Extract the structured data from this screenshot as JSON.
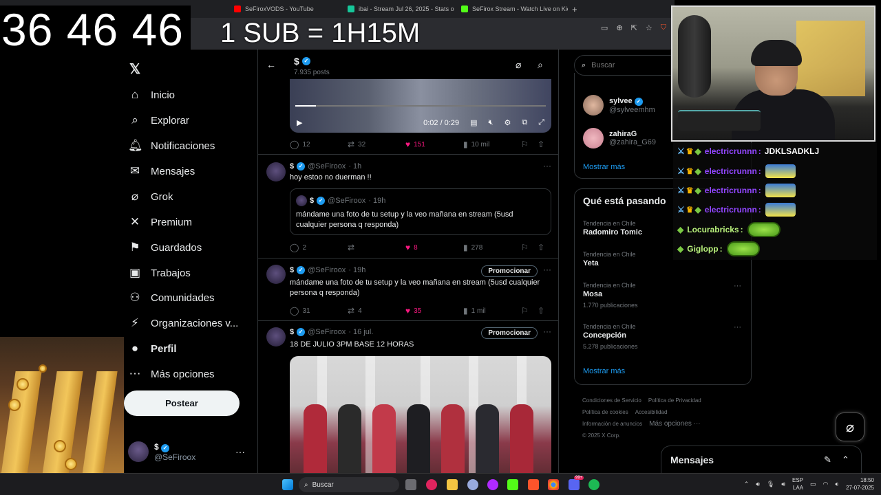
{
  "overlay": {
    "timer": "36 46 46",
    "sub_rate": "1 SUB = 1H15M"
  },
  "browser": {
    "tabs": [
      {
        "label": "SeFiroxVODS - YouTube",
        "color": "#ff0000"
      },
      {
        "label": "ibai - Stream Jul 26, 2025 - Stats on",
        "color": "#16c79a"
      },
      {
        "label": "SeFirox Stream - Watch Live on Kick",
        "color": "#53fc18"
      }
    ],
    "new_tab": "+"
  },
  "x": {
    "logo": "𝕏",
    "nav": [
      {
        "label": "Inicio",
        "icon": "home-icon",
        "glyph": "⌂"
      },
      {
        "label": "Explorar",
        "icon": "search-icon",
        "glyph": "⌕"
      },
      {
        "label": "Notificaciones",
        "icon": "bell-icon",
        "glyph": "🔔︎"
      },
      {
        "label": "Mensajes",
        "icon": "mail-icon",
        "glyph": "✉"
      },
      {
        "label": "Grok",
        "icon": "grok-icon",
        "glyph": "⌀"
      },
      {
        "label": "Premium",
        "icon": "x-premium-icon",
        "glyph": "✕"
      },
      {
        "label": "Guardados",
        "icon": "bookmark-icon",
        "glyph": "⚑"
      },
      {
        "label": "Trabajos",
        "icon": "briefcase-icon",
        "glyph": "▣"
      },
      {
        "label": "Comunidades",
        "icon": "community-icon",
        "glyph": "⚇"
      },
      {
        "label": "Organizaciones v...",
        "icon": "lightning-icon",
        "glyph": "⚡︎"
      },
      {
        "label": "Perfil",
        "icon": "person-icon",
        "glyph": "●"
      },
      {
        "label": "Más opciones",
        "icon": "more-icon",
        "glyph": "⋯"
      }
    ],
    "post_button": "Postear",
    "account": {
      "name": "$",
      "handle": "@SeFiroox",
      "more": "···"
    }
  },
  "profile_header": {
    "name": "$",
    "posts": "7.935 posts"
  },
  "tweets": [
    {
      "video_time": "0:02 / 0:29",
      "stats": {
        "replies": "12",
        "retweets": "32",
        "likes": "151",
        "views": "10 mil"
      }
    },
    {
      "name": "$",
      "handle": "@SeFiroox",
      "time": "· 1h",
      "text": "hoy estoo no duerman !!",
      "quote": {
        "name": "$",
        "handle": "@SeFiroox",
        "time": "· 19h",
        "text": "mándame una foto de tu setup y la veo mañana en stream (5usd cualquier persona q responda)"
      },
      "stats": {
        "replies": "2",
        "retweets": "",
        "likes": "8",
        "views": "278"
      }
    },
    {
      "name": "$",
      "handle": "@SeFiroox",
      "time": "· 19h",
      "promote": "Promocionar",
      "text": "mándame una foto de tu setup y la veo mañana en stream (5usd cualquier persona q responda)",
      "stats": {
        "replies": "31",
        "retweets": "4",
        "likes": "35",
        "views": "1 mil"
      }
    },
    {
      "name": "$",
      "handle": "@SeFiroox",
      "time": "· 16 jul.",
      "promote": "Promocionar",
      "text": "18 DE JULIO 3PM BASE 12 HORAS"
    }
  ],
  "sidebar": {
    "search_placeholder": "Buscar",
    "follow": [
      {
        "name": "sylvee",
        "handle": "@sylveemhm"
      },
      {
        "name": "zahiraG",
        "handle": "@zahira_G69"
      }
    ],
    "show_more": "Mostrar más",
    "trends_title": "Qué está pasando",
    "trends": [
      {
        "label": "Tendencia en Chile",
        "name": "Radomiro Tomic",
        "count": ""
      },
      {
        "label": "Tendencia en Chile",
        "name": "Yeta",
        "count": ""
      },
      {
        "label": "Tendencia en Chile",
        "name": "Mosa",
        "count": "1.770 publicaciones"
      },
      {
        "label": "Tendencia en Chile",
        "name": "Concepción",
        "count": "5.278 publicaciones"
      }
    ],
    "trends_more": "Mostrar más",
    "footer": {
      "l1a": "Condiciones de Servicio",
      "l1b": "Política de Privacidad",
      "l2a": "Política de cookies",
      "l2b": "Accesibilidad",
      "l3a": "Información de anuncios",
      "l3b": "Más opciones ···",
      "copy": "© 2025 X Corp."
    }
  },
  "messages_drawer": {
    "title": "Mensajes"
  },
  "chat": [
    {
      "name": "electricrunnn",
      "msg": "JDKLSADKLJ",
      "type": "text"
    },
    {
      "name": "electricrunnn",
      "msg": "",
      "type": "emote"
    },
    {
      "name": "electricrunnn",
      "msg": "",
      "type": "emote"
    },
    {
      "name": "electricrunnn",
      "msg": "",
      "type": "emote"
    },
    {
      "name": "Locurabricks",
      "msg": "",
      "type": "emote2"
    },
    {
      "name": "Giglopp",
      "msg": "",
      "type": "emote2"
    }
  ],
  "taskbar": {
    "search": "Buscar",
    "lang1": "ESP",
    "lang2": "LAA",
    "time": "18:50",
    "date": "27-07-2025",
    "badge": "99+"
  }
}
